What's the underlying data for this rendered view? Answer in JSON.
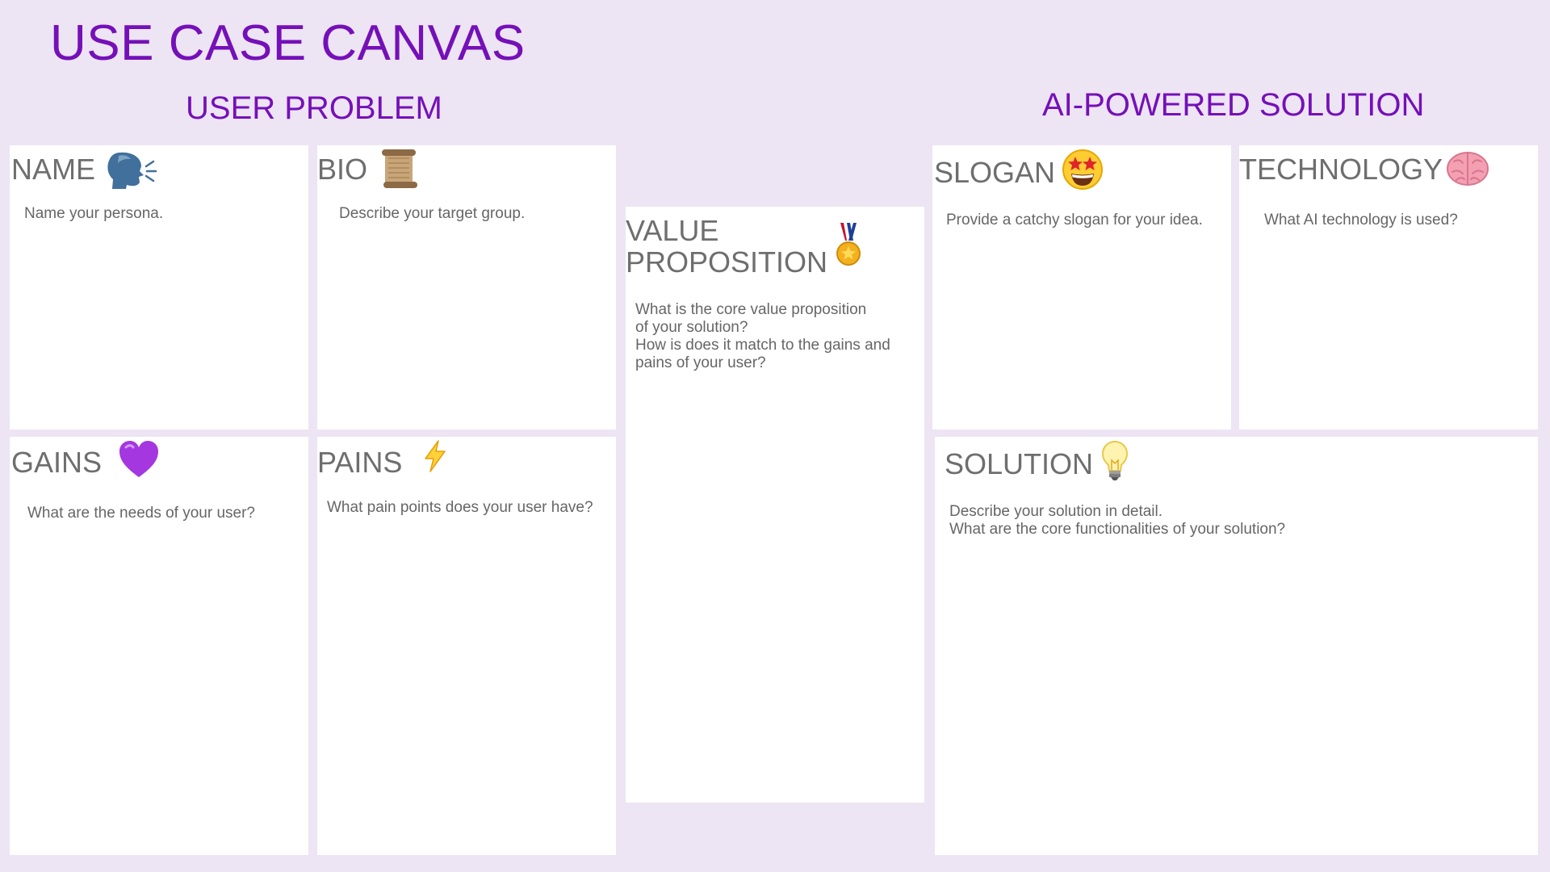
{
  "page": {
    "title": "USE CASE CANVAS",
    "section_user_problem": "USER PROBLEM",
    "section_ai_solution": "AI-POWERED SOLUTION"
  },
  "colors": {
    "background": "#ede4f4",
    "accent": "#7510b8",
    "card": "#ffffff",
    "card_title": "#6e6e6e",
    "card_text": "#666666"
  },
  "cards": {
    "name": {
      "title": "NAME",
      "icon": "speaking-head-icon",
      "description": [
        "Name your persona."
      ]
    },
    "bio": {
      "title": "BIO",
      "icon": "scroll-icon",
      "description": [
        "Describe your target group."
      ]
    },
    "value_proposition": {
      "title": [
        "VALUE",
        "PROPOSITION"
      ],
      "icon": "medal-icon",
      "description": [
        "What is the core value proposition",
        "of your solution?",
        "How is does it match to the gains and",
        "pains of your user?"
      ]
    },
    "slogan": {
      "title": "SLOGAN",
      "icon": "star-struck-face-icon",
      "description": [
        "Provide a catchy slogan for your idea."
      ]
    },
    "technology": {
      "title": "TECHNOLOGY",
      "icon": "brain-icon",
      "description": [
        "What AI technology is used?"
      ]
    },
    "gains": {
      "title": "GAINS",
      "icon": "purple-heart-icon",
      "description": [
        "What are the needs of your user?"
      ]
    },
    "pains": {
      "title": "PAINS",
      "icon": "lightning-bolt-icon",
      "description": [
        "What pain points does your user have?"
      ]
    },
    "solution": {
      "title": "SOLUTION",
      "icon": "light-bulb-icon",
      "description": [
        "Describe your solution in detail.",
        "What are the core functionalities of your solution?"
      ]
    }
  }
}
